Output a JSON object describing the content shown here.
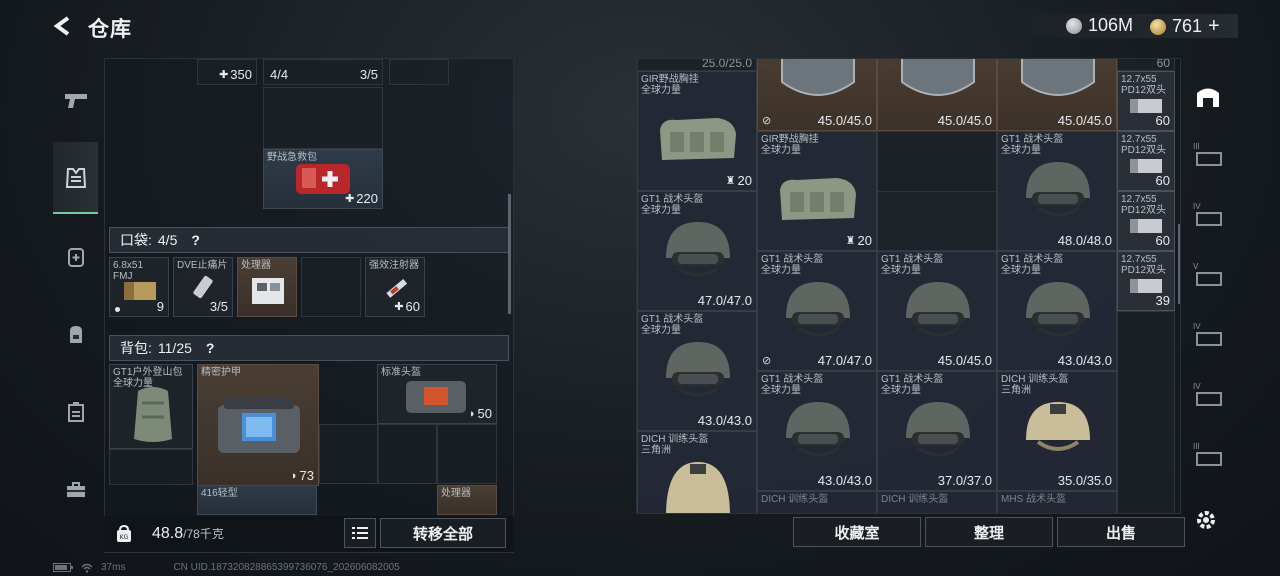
{
  "header": {
    "title": "仓库",
    "currency_silver": "106M",
    "currency_gold": "761",
    "plus": "+"
  },
  "left_top": {
    "cell_a_val": "350",
    "cell_b_val": "4/4",
    "cell_c_val": "3/5",
    "firstaid_name": "野战急救包",
    "firstaid_val": "220"
  },
  "pockets": {
    "label": "口袋:",
    "count": "4/5",
    "help": "?",
    "items": [
      {
        "name": "6.8x51\nFMJ",
        "val": "9"
      },
      {
        "name": "DVE止痛片",
        "val": "3/5"
      },
      {
        "name": "处理器",
        "val": ""
      },
      {
        "name": "",
        "val": ""
      },
      {
        "name": "强效注射器",
        "val": "60"
      }
    ]
  },
  "backpack": {
    "label": "背包:",
    "count": "11/25",
    "help": "?",
    "items": [
      {
        "name": "GT1户外登山包\n全球力量",
        "val": ""
      },
      {
        "name": "精密护甲",
        "val": "73"
      },
      {
        "name": "标准头盔",
        "val": "50"
      },
      {
        "name": "416轻型",
        "val": ""
      },
      {
        "name": "处理器",
        "val": ""
      }
    ]
  },
  "weight": {
    "current": "48.8",
    "max": "/78千克"
  },
  "transfer_all": "转移全部",
  "right_buttons": [
    "收藏室",
    "整理",
    "出售"
  ],
  "right_items": {
    "top_partial": "25.0/25.0",
    "top_right_partial": "60",
    "gir1": {
      "name": "GIR野战胸挂\n全球力量",
      "val": "20"
    },
    "gir2": {
      "name": "GIR野战胸挂\n全球力量",
      "val": "20"
    },
    "visor1": "45.0/45.0",
    "visor2": "45.0/45.0",
    "visor3": "45.0/45.0",
    "gt1_1": {
      "name": "GT1 战术头盔\n全球力量",
      "val": "48.0/48.0"
    },
    "gt1_2": {
      "name": "GT1 战术头盔\n全球力量",
      "val": "47.0/47.0"
    },
    "gt1_3": {
      "name": "GT1 战术头盔\n全球力量",
      "val": "47.0/47.0"
    },
    "gt1_4": {
      "name": "GT1 战术头盔\n全球力量",
      "val": "45.0/45.0"
    },
    "gt1_5": {
      "name": "GT1 战术头盔\n全球力量",
      "val": "43.0/43.0"
    },
    "gt1_6": {
      "name": "GT1 战术头盔\n全球力量",
      "val": "43.0/43.0"
    },
    "gt1_7": {
      "name": "GT1 战术头盔\n全球力量",
      "val": "43.0/43.0"
    },
    "gt1_8": {
      "name": "GT1 战术头盔\n全球力量",
      "val": "37.0/37.0"
    },
    "dich1": {
      "name": "DICH 训练头盔\n三角洲",
      "val": "35.0/35.0"
    },
    "dich2": {
      "name": "DICH 训练头盔\n三角洲",
      "val": ""
    },
    "bottom_partials": [
      "DICH 训练头盔",
      "DICH 训练头盔",
      "MHS 战术头盔"
    ],
    "ammo": [
      {
        "name": "12.7x55\nPD12双头",
        "val": "60"
      },
      {
        "name": "12.7x55\nPD12双头",
        "val": "60"
      },
      {
        "name": "12.7x55\nPD12双头",
        "val": "60"
      },
      {
        "name": "12.7x55\nPD12双头",
        "val": "39"
      }
    ]
  },
  "right_sidebar": [
    "",
    "III",
    "IV",
    "V",
    "IV",
    "IV",
    "III"
  ],
  "footer": {
    "ping": "37ms",
    "uid": "CN UID.187320828865399736076_202606082005"
  }
}
